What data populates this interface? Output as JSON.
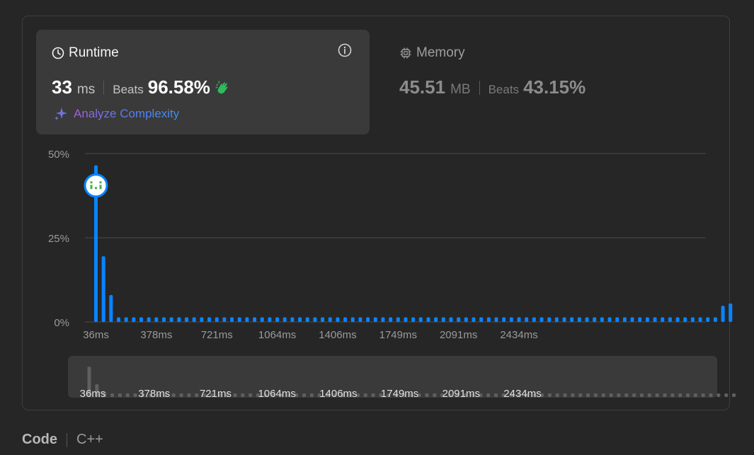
{
  "runtime": {
    "title": "Runtime",
    "value": "33",
    "unit": "ms",
    "beats_label": "Beats",
    "beats_value": "96.58%",
    "analyze_label": "Analyze Complexity"
  },
  "memory": {
    "title": "Memory",
    "value": "45.51",
    "unit": "MB",
    "beats_label": "Beats",
    "beats_value": "43.15%"
  },
  "footer": {
    "code_label": "Code",
    "language": "C++"
  },
  "colors": {
    "bar": "#0a84ff",
    "overview_bar": "#5f5f5f",
    "marker_face": "#4caf50",
    "clap": "#2cbb5d"
  },
  "chart_data": {
    "type": "bar",
    "ylim": [
      0,
      50
    ],
    "y_ticks": [
      "50%",
      "25%",
      "0%"
    ],
    "x_tick_labels": [
      "36ms",
      "378ms",
      "721ms",
      "1064ms",
      "1406ms",
      "1749ms",
      "2091ms",
      "2434ms"
    ],
    "values": [
      46.5,
      19.5,
      8.0,
      1.4,
      1.4,
      1.4,
      1.4,
      1.4,
      1.4,
      1.4,
      1.4,
      1.4,
      1.4,
      1.4,
      1.4,
      1.4,
      1.4,
      1.4,
      1.4,
      1.4,
      1.4,
      1.4,
      1.4,
      1.4,
      1.4,
      1.4,
      1.4,
      1.4,
      1.4,
      1.4,
      1.4,
      1.4,
      1.4,
      1.4,
      1.4,
      1.4,
      1.4,
      1.4,
      1.4,
      1.4,
      1.4,
      1.4,
      1.4,
      1.4,
      1.4,
      1.4,
      1.4,
      1.4,
      1.4,
      1.4,
      1.4,
      1.4,
      1.4,
      1.4,
      1.4,
      1.4,
      1.4,
      1.4,
      1.4,
      1.4,
      1.4,
      1.4,
      1.4,
      1.4,
      1.4,
      1.4,
      1.4,
      1.4,
      1.4,
      1.4,
      1.4,
      1.4,
      1.4,
      1.4,
      1.4,
      1.4,
      1.4,
      1.4,
      1.4,
      1.4,
      1.4,
      1.4,
      1.4,
      4.8,
      5.5
    ],
    "highlight_index": 0,
    "highlight_value": 40.5,
    "overview_labels": [
      "36ms",
      "378ms",
      "721ms",
      "1064ms",
      "1406ms",
      "1749ms",
      "2091ms",
      "2434ms"
    ]
  }
}
